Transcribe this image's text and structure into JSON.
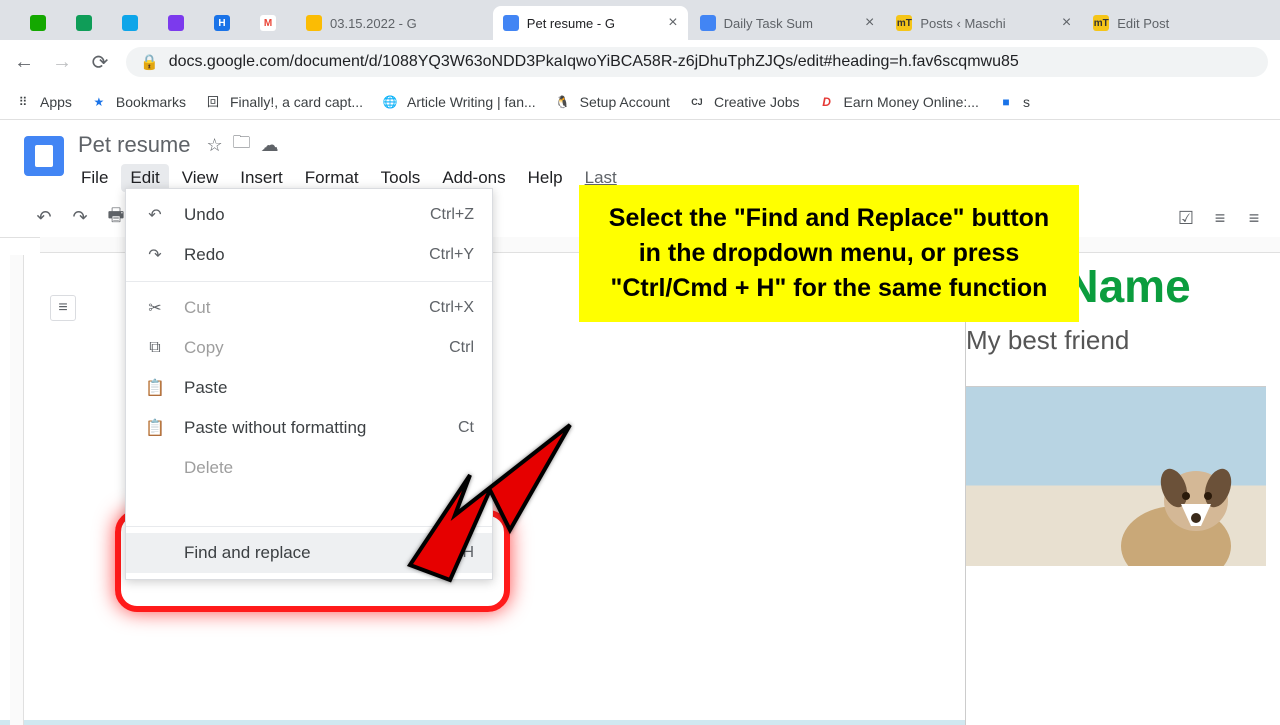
{
  "tabs": [
    {
      "title": "",
      "favicon_bg": "#14a800"
    },
    {
      "title": "",
      "favicon_bg": "#0f9d58"
    },
    {
      "title": "",
      "favicon_bg": "#0ea5e9"
    },
    {
      "title": "",
      "favicon_bg": "#7c3aed"
    },
    {
      "title": "",
      "favicon_bg": "#1a73e8"
    },
    {
      "title": "",
      "favicon_bg": "#ea4335"
    },
    {
      "title": "03.15.2022 - G",
      "favicon_bg": "#fbbc04"
    },
    {
      "title": "Pet resume - G",
      "favicon_bg": "#4285f4",
      "active": true
    },
    {
      "title": "Daily Task Sum",
      "favicon_bg": "#4285f4"
    },
    {
      "title": "Posts ‹ Maschi",
      "favicon_bg": "#f5c518",
      "fav_text": "mT"
    },
    {
      "title": "Edit Post",
      "favicon_bg": "#f5c518",
      "fav_text": "mT"
    }
  ],
  "url": "docs.google.com/document/d/1088YQ3W63oNDD3PkaIqwoYiBCA58R-z6jDhuTphZJQs/edit#heading=h.fav6scqmwu85",
  "bookmarks": [
    {
      "label": "Apps",
      "icon": "⠿",
      "color": "#5f6368"
    },
    {
      "label": "Bookmarks",
      "icon": "★",
      "color": "#1a73e8"
    },
    {
      "label": "Finally!, a card capt...",
      "icon": "回",
      "color": "#5f6368"
    },
    {
      "label": "Article Writing | fan...",
      "icon": "🌐",
      "color": "#5f6368"
    },
    {
      "label": "Setup Account",
      "icon": "🐧",
      "color": "#5f6368"
    },
    {
      "label": "Creative Jobs",
      "icon": "CJ",
      "color": "#202124"
    },
    {
      "label": "Earn Money Online:...",
      "icon": "D",
      "color": "#e53935"
    },
    {
      "label": "s",
      "icon": "■",
      "color": "#1a73e8"
    }
  ],
  "document": {
    "title": "Pet resume",
    "menu": [
      "File",
      "Edit",
      "View",
      "Insert",
      "Format",
      "Tools",
      "Add-ons",
      "Help"
    ],
    "last_edit": "Last"
  },
  "edit_menu": {
    "undo": {
      "label": "Undo",
      "shortcut": "Ctrl+Z"
    },
    "redo": {
      "label": "Redo",
      "shortcut": "Ctrl+Y"
    },
    "cut": {
      "label": "Cut",
      "shortcut": "Ctrl+X"
    },
    "copy": {
      "label": "Copy",
      "shortcut": "Ctrl"
    },
    "paste": {
      "label": "Paste"
    },
    "paste_without": {
      "label": "Paste without formatting",
      "shortcut": "Ct"
    },
    "delete": {
      "label": "Delete"
    },
    "find_replace": {
      "label": "Find and replace",
      "shortcut": "Ctrl+H"
    }
  },
  "callout_text": "Select the \"Find and Replace\" button in the dropdown menu, or press \"Ctrl/Cmd + H\" for the same function",
  "doc_content": {
    "heading": "Pet Name",
    "subheading": "My best friend"
  }
}
